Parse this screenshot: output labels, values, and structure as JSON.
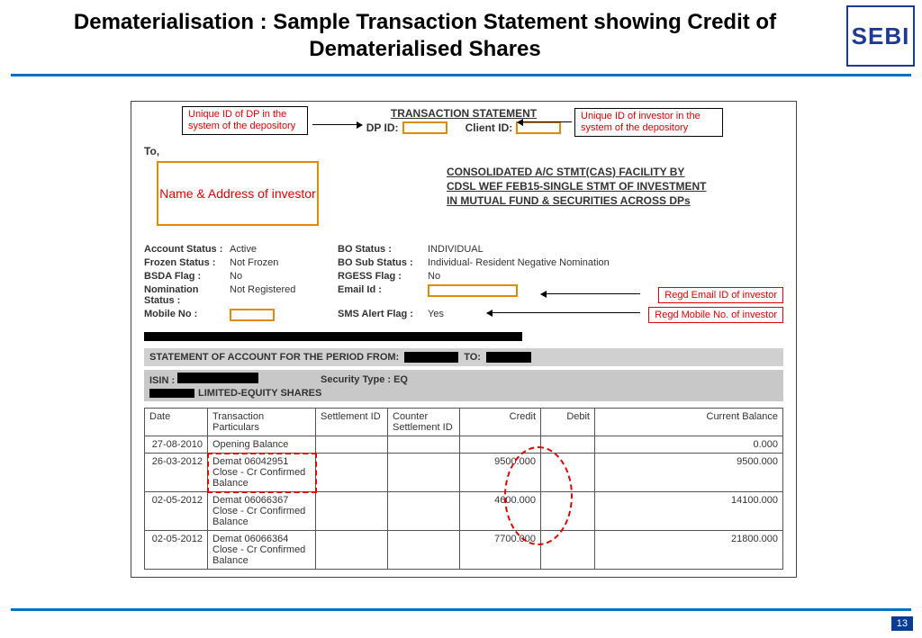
{
  "slide": {
    "title": "Dematerialisation : Sample Transaction Statement showing Credit of Dematerialised Shares",
    "logo_text": "SEBI",
    "page_number": "13"
  },
  "statement": {
    "header": "TRANSACTION STATEMENT",
    "dp_id_label": "DP ID:",
    "client_id_label": "Client ID:",
    "to_label": "To,",
    "name_addr_placeholder": "Name & Address of investor",
    "consolidated_note_l1": "CONSOLIDATED A/C STMT(CAS) FACILITY BY",
    "consolidated_note_l2": "CDSL WEF FEB15-SINGLE STMT OF INVESTMENT",
    "consolidated_note_l3": "IN MUTUAL FUND & SECURITIES ACROSS DPs",
    "fields": {
      "account_status_k": "Account Status :",
      "account_status_v": "Active",
      "frozen_status_k": "Frozen Status :",
      "frozen_status_v": "Not Frozen",
      "bsda_flag_k": "BSDA Flag :",
      "bsda_flag_v": "No",
      "nomination_status_k": "Nomination Status :",
      "nomination_status_v": "Not Registered",
      "mobile_no_k": "Mobile No :",
      "bo_status_k": "BO Status :",
      "bo_status_v": "INDIVIDUAL",
      "bo_sub_status_k": "BO Sub Status :",
      "bo_sub_status_v": "Individual- Resident Negative Nomination",
      "rgess_flag_k": "RGESS Flag :",
      "rgess_flag_v": "No",
      "email_id_k": "Email Id :",
      "sms_alert_k": "SMS Alert Flag :",
      "sms_alert_v": "Yes"
    },
    "period_label": "STATEMENT OF ACCOUNT FOR THE PERIOD FROM:",
    "period_to_label": "TO:",
    "isin_label": "ISIN :",
    "security_type_label": "Security Type : EQ",
    "security_name": "LIMITED-EQUITY SHARES",
    "table": {
      "headers": [
        "Date",
        "Transaction Particulars",
        "Settlement ID",
        "Counter Settlement ID",
        "Credit",
        "Debit",
        "Current Balance"
      ],
      "rows": [
        {
          "date": "27-08-2010",
          "particulars": "Opening Balance",
          "settlement": "",
          "counter": "",
          "credit": "",
          "debit": "",
          "balance": "0.000"
        },
        {
          "date": "26-03-2012",
          "particulars": "Demat 06042951 Close - Cr Confirmed Balance",
          "settlement": "",
          "counter": "",
          "credit": "9500.000",
          "debit": "",
          "balance": "9500.000"
        },
        {
          "date": "02-05-2012",
          "particulars": "Demat 06066367 Close - Cr Confirmed Balance",
          "settlement": "",
          "counter": "",
          "credit": "4600.000",
          "debit": "",
          "balance": "14100.000"
        },
        {
          "date": "02-05-2012",
          "particulars": "Demat 06066364 Close - Cr Confirmed Balance",
          "settlement": "",
          "counter": "",
          "credit": "7700.000",
          "debit": "",
          "balance": "21800.000"
        }
      ]
    }
  },
  "callouts": {
    "dp_id_note": "Unique ID of DP in the system of the depository",
    "client_id_note": "Unique ID of investor in the system of the depository",
    "email_note": "Regd Email ID of investor",
    "mobile_note": "Regd Mobile No. of investor"
  }
}
